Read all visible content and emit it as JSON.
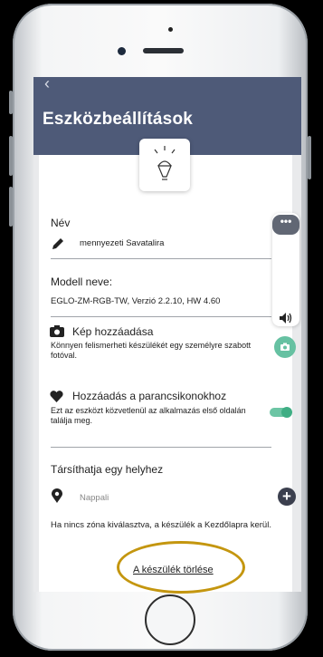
{
  "header": {
    "title": "Eszközbeállítások",
    "back_glyph": "‹"
  },
  "device_icon": "lightbulb-icon",
  "name_section": {
    "label": "Név",
    "value": "mennyezeti Savatalira"
  },
  "model_section": {
    "label": "Modell neve:",
    "value": "EGLO-ZM-RGB-TW, Verzió 2.2.10, HW 4.60"
  },
  "image_section": {
    "title": "Kép hozzáadása",
    "description": "Könnyen felismerheti készülékét egy személyre szabott fotóval."
  },
  "shortcut_section": {
    "title": "Hozzáadás a parancsikonokhoz",
    "description": "Ezt az eszközt közvetlenül az alkalmazás első oldalán találja meg.",
    "enabled": true
  },
  "location_section": {
    "label": "Társíthatja egy helyhez",
    "placeholder": "Nappali",
    "note": "Ha nincs zóna kiválasztva, a készülék a Kezdőlapra kerül."
  },
  "delete_link": "A készülék törlése",
  "overlay": {
    "dots": "•••",
    "volume_icon": "speaker-icon"
  },
  "colors": {
    "header": "#4e5a78",
    "accent_green": "#3fae84",
    "highlight": "#c4960f"
  }
}
